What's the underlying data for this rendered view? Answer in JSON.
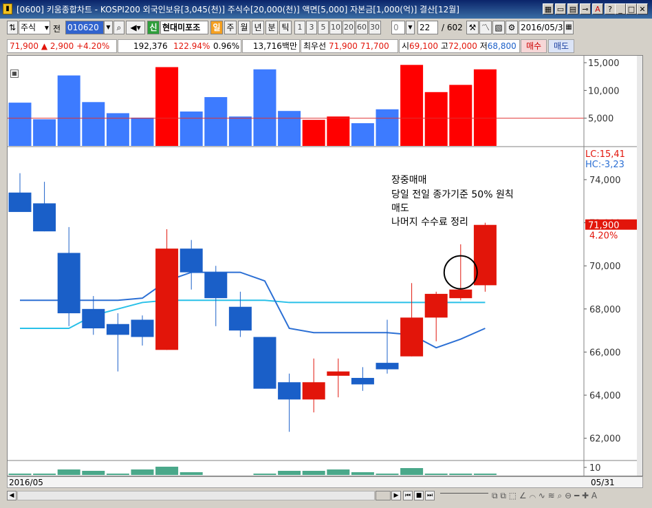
{
  "window": {
    "title": "[0600] 키움종합차트 - KOSPI200 외국인보유[3,045(천)] 주식수[20,000(천)] 액면[5,000] 자본금[1,000(억)] 결산[12월]"
  },
  "toolbar": {
    "market_type": "주식",
    "prev_label": "전",
    "stock_code": "010620",
    "credit_badge": "신",
    "stock_name": "현대미포조",
    "period_selected": "일",
    "periods": [
      "주",
      "월",
      "년",
      "분",
      "틱"
    ],
    "intervals": [
      "1",
      "3",
      "5",
      "10",
      "20",
      "60",
      "30"
    ],
    "interval_input": "0",
    "count_value": "22",
    "count_total": "/ 602",
    "date_value": "2016/05/3"
  },
  "quote": {
    "price": "71,900",
    "change": "▲ 2,900",
    "change_pct": "+4.20%",
    "volume": "192,376",
    "volume_ratio": "122.94%",
    "turnover": "0.96%",
    "trade_value": "13,716백만",
    "best_bid_label": "최우선",
    "best_ask": "71,900",
    "best_bid": "71,700",
    "open_label": "시",
    "open": "69,100",
    "high_label": "고",
    "high": "72,000",
    "low_label": "저",
    "low": "68,800",
    "buy_label": "매수",
    "sell_label": "매도"
  },
  "colors": {
    "up": "#e2150a",
    "down": "#1a5fc8",
    "volume_up": "#ff0000",
    "volume_down": "#3d7bff",
    "ma_dark": "#2b6fd4",
    "ma_light": "#27c0e8",
    "price_box": "#e2150a"
  },
  "chart_data": [
    {
      "type": "bar",
      "name": "volume",
      "ylim": [
        0,
        16000
      ],
      "y_ticks": [
        "15,000",
        "10,000",
        "5,000"
      ],
      "y_tick_values": [
        15000,
        10000,
        5000
      ],
      "reference_line": 5000,
      "values": [
        7800,
        4800,
        12700,
        7900,
        5900,
        5100,
        14200,
        6200,
        8800,
        5300,
        13800,
        6300,
        4700,
        5300,
        4100,
        6600,
        14600,
        9700,
        11000,
        13800
      ],
      "directions": [
        "down",
        "down",
        "down",
        "down",
        "down",
        "down",
        "up",
        "down",
        "down",
        "down",
        "down",
        "down",
        "up",
        "up",
        "down",
        "down",
        "up",
        "up",
        "up",
        "up"
      ]
    },
    {
      "type": "candlestick",
      "name": "price",
      "ylim": [
        61000,
        75500
      ],
      "y_ticks": [
        "74,000",
        "72,000",
        "70,000",
        "68,000",
        "66,000",
        "64,000",
        "62,000"
      ],
      "y_tick_values": [
        74000,
        72000,
        70000,
        68000,
        66000,
        64000,
        62000
      ],
      "lc_label": "LC:15,41",
      "hc_label": "HC:-3,23",
      "last_price_label": "71,900",
      "last_pct_label": "4.20%",
      "candles": [
        {
          "o": 73400,
          "h": 74300,
          "l": 72600,
          "c": 72500
        },
        {
          "o": 72900,
          "h": 73900,
          "l": 71600,
          "c": 71600
        },
        {
          "o": 70600,
          "h": 71800,
          "l": 67200,
          "c": 67800
        },
        {
          "o": 68000,
          "h": 68600,
          "l": 66800,
          "c": 67100
        },
        {
          "o": 67300,
          "h": 67800,
          "l": 65100,
          "c": 66800
        },
        {
          "o": 67500,
          "h": 67700,
          "l": 66300,
          "c": 66700
        },
        {
          "o": 66100,
          "h": 71700,
          "l": 66100,
          "c": 70800
        },
        {
          "o": 70800,
          "h": 71200,
          "l": 68900,
          "c": 69700
        },
        {
          "o": 69700,
          "h": 70000,
          "l": 67200,
          "c": 68500
        },
        {
          "o": 68100,
          "h": 68800,
          "l": 66700,
          "c": 67000
        },
        {
          "o": 66700,
          "h": 66700,
          "l": 64300,
          "c": 64300
        },
        {
          "o": 64600,
          "h": 65000,
          "l": 62300,
          "c": 63800
        },
        {
          "o": 63800,
          "h": 65700,
          "l": 63200,
          "c": 64600
        },
        {
          "o": 64900,
          "h": 65700,
          "l": 63900,
          "c": 65100
        },
        {
          "o": 64800,
          "h": 65300,
          "l": 64200,
          "c": 64500
        },
        {
          "o": 65500,
          "h": 67500,
          "l": 65000,
          "c": 65200
        },
        {
          "o": 65800,
          "h": 69200,
          "l": 65800,
          "c": 67600
        },
        {
          "o": 67600,
          "h": 68800,
          "l": 66500,
          "c": 68700
        },
        {
          "o": 68500,
          "h": 71000,
          "l": 68400,
          "c": 68900
        },
        {
          "o": 69100,
          "h": 72000,
          "l": 68800,
          "c": 71900
        }
      ],
      "ma_dark": {
        "start_index": 0,
        "values": [
          68400,
          68400,
          68400,
          68400,
          68400,
          68500,
          69300,
          69700,
          69700,
          69700,
          69300,
          67100,
          66900,
          66900,
          66900,
          66900,
          66800,
          66200,
          66600,
          67100
        ]
      },
      "ma_light": {
        "start_index": 0,
        "values": [
          67100,
          67100,
          67100,
          67700,
          68000,
          68300,
          68400,
          68400,
          68400,
          68400,
          68400,
          68300,
          68300,
          68300,
          68300,
          68300,
          68300,
          68300,
          68300,
          68300
        ]
      }
    },
    {
      "type": "bar",
      "name": "indicator",
      "y_ticks": [
        "10"
      ],
      "values": [
        1,
        1,
        4,
        3,
        1,
        4,
        6,
        2,
        0,
        0,
        1,
        3,
        3,
        4,
        2,
        1,
        5,
        1,
        1,
        1
      ]
    }
  ],
  "annotation": {
    "line1": "장중매매",
    "line2": "당일 전일 종가기준 50% 원칙",
    "line3": "매도",
    "line4": "나머지 수수료 정리"
  },
  "footer": {
    "date_start": "2016/05",
    "date_end": "05/31"
  }
}
